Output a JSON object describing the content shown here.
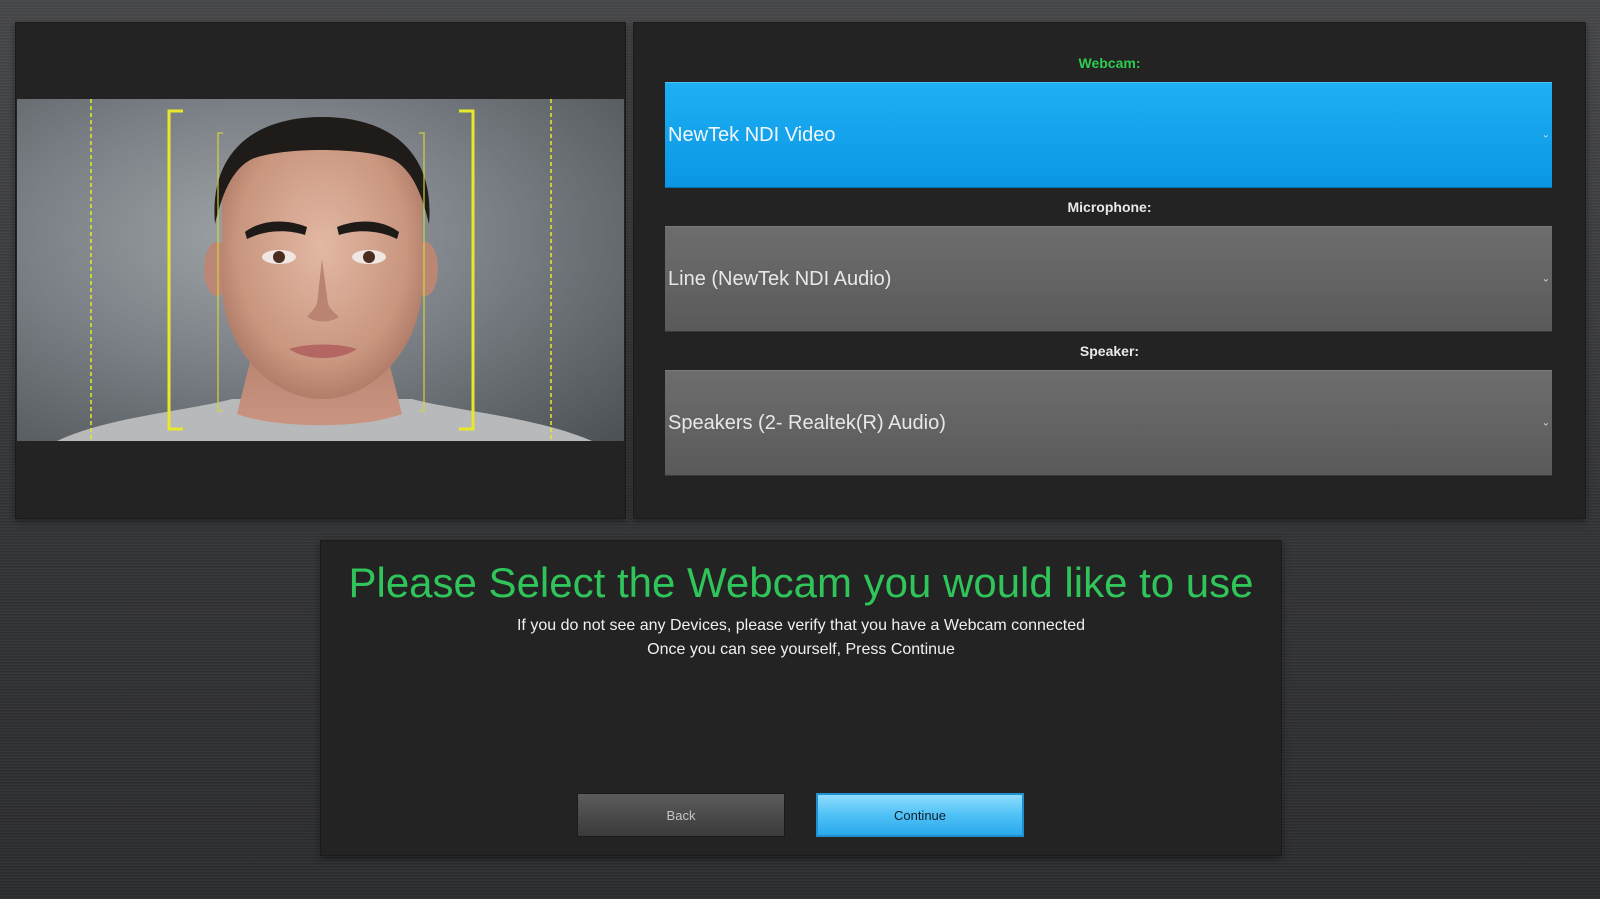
{
  "devices": {
    "webcam": {
      "label": "Webcam:",
      "value": "NewTek NDI Video"
    },
    "microphone": {
      "label": "Microphone:",
      "value": "Line (NewTek NDI Audio)"
    },
    "speaker": {
      "label": "Speaker:",
      "value": "Speakers (2- Realtek(R) Audio)"
    },
    "dropdown_icon": "chevron-down-icon"
  },
  "message": {
    "headline": "Please Select the Webcam you would like to use",
    "line1": "If you do not see any Devices, please verify that you have a Webcam connected",
    "line2": "Once you can see yourself, Press Continue"
  },
  "buttons": {
    "back_label": "Back",
    "continue_label": "Continue"
  },
  "colors": {
    "accent_green": "#2fc55a",
    "selected_blue": "#0a96e4",
    "guide_yellow": "#e8e82a"
  }
}
